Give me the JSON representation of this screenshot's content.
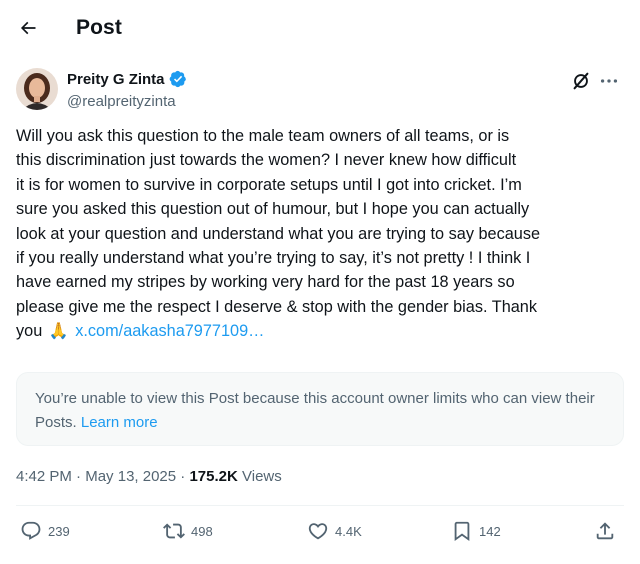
{
  "header": {
    "title": "Post",
    "back_icon": "arrow-left-icon"
  },
  "author": {
    "display_name": "Preity G Zinta",
    "handle": "@realpreityzinta",
    "verified_color": "#1d9bf0"
  },
  "tweet": {
    "lines": [
      "Will you ask this question to the male team owners of all  teams, or is",
      "this  discrimination just towards the women?  I never knew how difficult",
      "it is for women to survive in corporate setups until I got into cricket. I’m",
      "sure you asked this question out of humour, but I hope you can actually",
      "look at your question and understand what you are trying to say because",
      "if you really understand what you’re trying to say, it’s not pretty ! I think I",
      "have earned my stripes  by working very hard for the past 18 years so",
      "please give me the respect I deserve & stop with the gender bias. Thank"
    ],
    "last_line_prefix": "you",
    "emoji": "🙏",
    "link": "x.com/aakasha7977109…"
  },
  "notice": {
    "text": "You’re unable to view this Post because this account owner limits who can view their Posts.",
    "learn_more": "Learn more"
  },
  "meta": {
    "time": "4:42 PM",
    "separator": "·",
    "date": "May 13, 2025",
    "views_count": "175.2K",
    "views_label": "Views"
  },
  "actions": {
    "replies": "239",
    "reposts": "498",
    "likes": "4.4K",
    "bookmarks": "142"
  },
  "colors": {
    "accent": "#1d9bf0",
    "secondary_text": "#536471",
    "primary_text": "#0f1419"
  }
}
